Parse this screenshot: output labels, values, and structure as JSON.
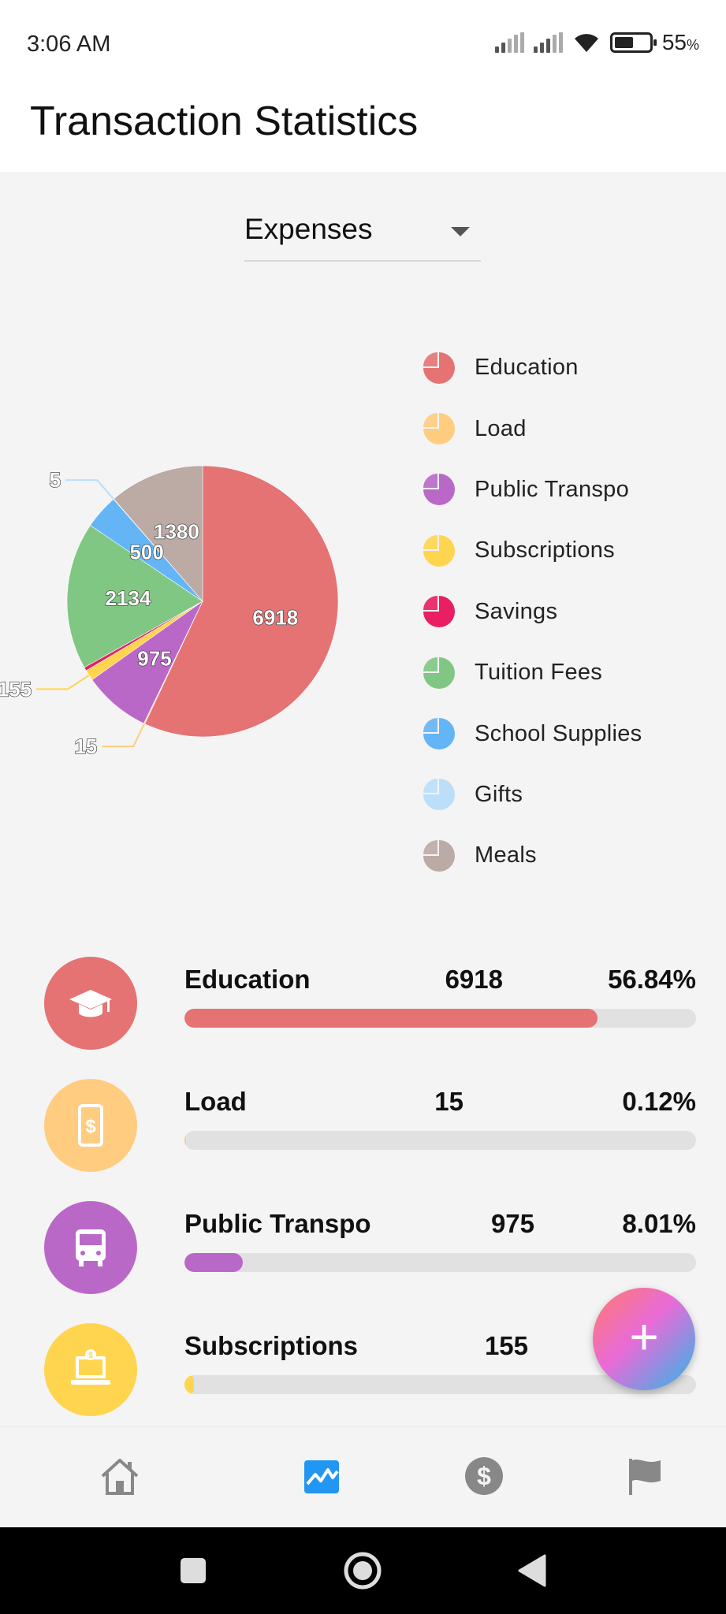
{
  "status_bar": {
    "time": "3:06 AM",
    "battery_percent": "55",
    "battery_unit": "%",
    "battery_level": 0.55,
    "icons": [
      "signal-icon",
      "signal-icon",
      "wifi-icon",
      "battery-icon"
    ]
  },
  "app_bar": {
    "title": "Transaction Statistics"
  },
  "filter": {
    "selected": "Expenses"
  },
  "chart_data": {
    "type": "pie",
    "categories": [
      "Education",
      "Load",
      "Public Transpo",
      "Subscriptions",
      "Savings",
      "Tuition Fees",
      "School Supplies",
      "Gifts",
      "Meals"
    ],
    "values": [
      6918,
      15,
      975,
      155,
      52,
      2134,
      500,
      5,
      1380
    ],
    "colors": [
      "#e57373",
      "#ffcc80",
      "#ba68c8",
      "#ffd54f",
      "#e91e63",
      "#81c784",
      "#64b5f6",
      "#bbdefb",
      "#bcaaa4"
    ],
    "labels": [
      "6918",
      "15",
      "975",
      "155",
      "",
      "2134",
      "500",
      "5",
      "1380"
    ],
    "legend_position": "right"
  },
  "legend": [
    {
      "label": "Education",
      "color": "#e57373"
    },
    {
      "label": "Load",
      "color": "#ffcc80"
    },
    {
      "label": "Public Transpo",
      "color": "#ba68c8"
    },
    {
      "label": "Subscriptions",
      "color": "#ffd54f"
    },
    {
      "label": "Savings",
      "color": "#e91e63"
    },
    {
      "label": "Tuition Fees",
      "color": "#81c784"
    },
    {
      "label": "School Supplies",
      "color": "#64b5f6"
    },
    {
      "label": "Gifts",
      "color": "#bbdefb"
    },
    {
      "label": "Meals",
      "color": "#bcaaa4"
    }
  ],
  "rows": [
    {
      "name": "Education",
      "amount": "6918",
      "percent": "56.84%",
      "fraction": 0.5684,
      "color": "#e57373",
      "icon": "graduation-cap-icon"
    },
    {
      "name": "Load",
      "amount": "15",
      "percent": "0.12%",
      "fraction": 0.0012,
      "color": "#ffcc80",
      "icon": "phone-dollar-icon"
    },
    {
      "name": "Public Transpo",
      "amount": "975",
      "percent": "8.01%",
      "fraction": 0.0801,
      "color": "#ba68c8",
      "icon": "bus-icon"
    },
    {
      "name": "Subscriptions",
      "amount": "155",
      "percent": "",
      "fraction": 0.0127,
      "color": "#ffd54f",
      "icon": "laptop-subscription-icon"
    }
  ],
  "fab": {
    "icon": "plus-icon",
    "label": "+"
  },
  "bottom_nav": [
    {
      "name": "home",
      "icon": "home-icon",
      "active": false
    },
    {
      "name": "statistics",
      "icon": "chart-icon",
      "active": true
    },
    {
      "name": "money",
      "icon": "dollar-icon",
      "active": false
    },
    {
      "name": "goals",
      "icon": "flag-icon",
      "active": false
    }
  ],
  "system_nav": [
    "recents-button",
    "home-button",
    "back-button"
  ]
}
